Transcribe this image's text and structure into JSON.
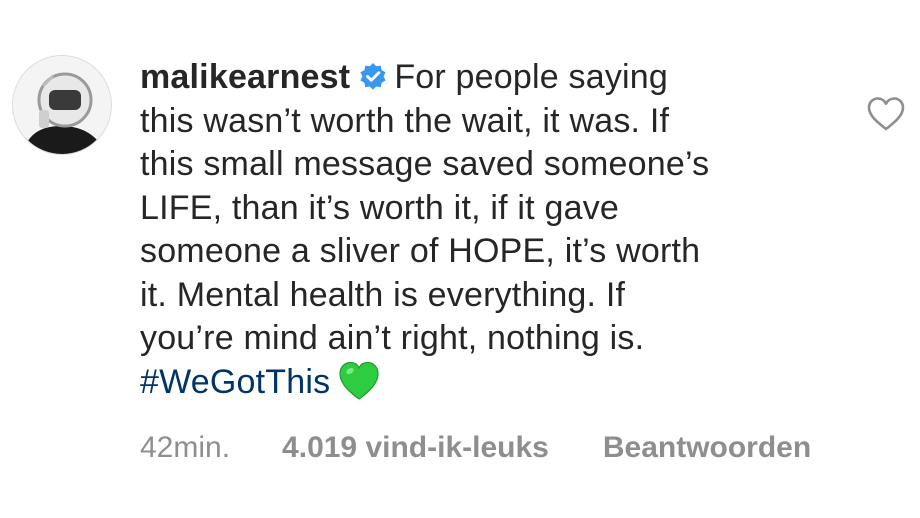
{
  "comment": {
    "username": "malikearnest",
    "verified": true,
    "text_lines": [
      "For people saying",
      "this wasn’t worth the wait, it was. If",
      "this small message saved someone’s",
      "LIFE, than it’s worth it, if it gave",
      "someone a sliver of HOPE, it’s worth",
      "it. Mental health is everything. If",
      "you’re mind ain’t right, nothing is."
    ],
    "hashtag": "#WeGotThis",
    "emoji": "green-heart-icon",
    "time": "42min.",
    "likes": "4.019 vind-ik-leuks",
    "reply_label": "Beantwoorden"
  },
  "icons": {
    "verified": "verified-badge-icon",
    "like": "heart-outline-icon"
  },
  "colors": {
    "text": "#262626",
    "meta": "#8e8e8e",
    "hashtag": "#003569",
    "verified": "#3897f0",
    "emoji": "#2ecc40"
  }
}
